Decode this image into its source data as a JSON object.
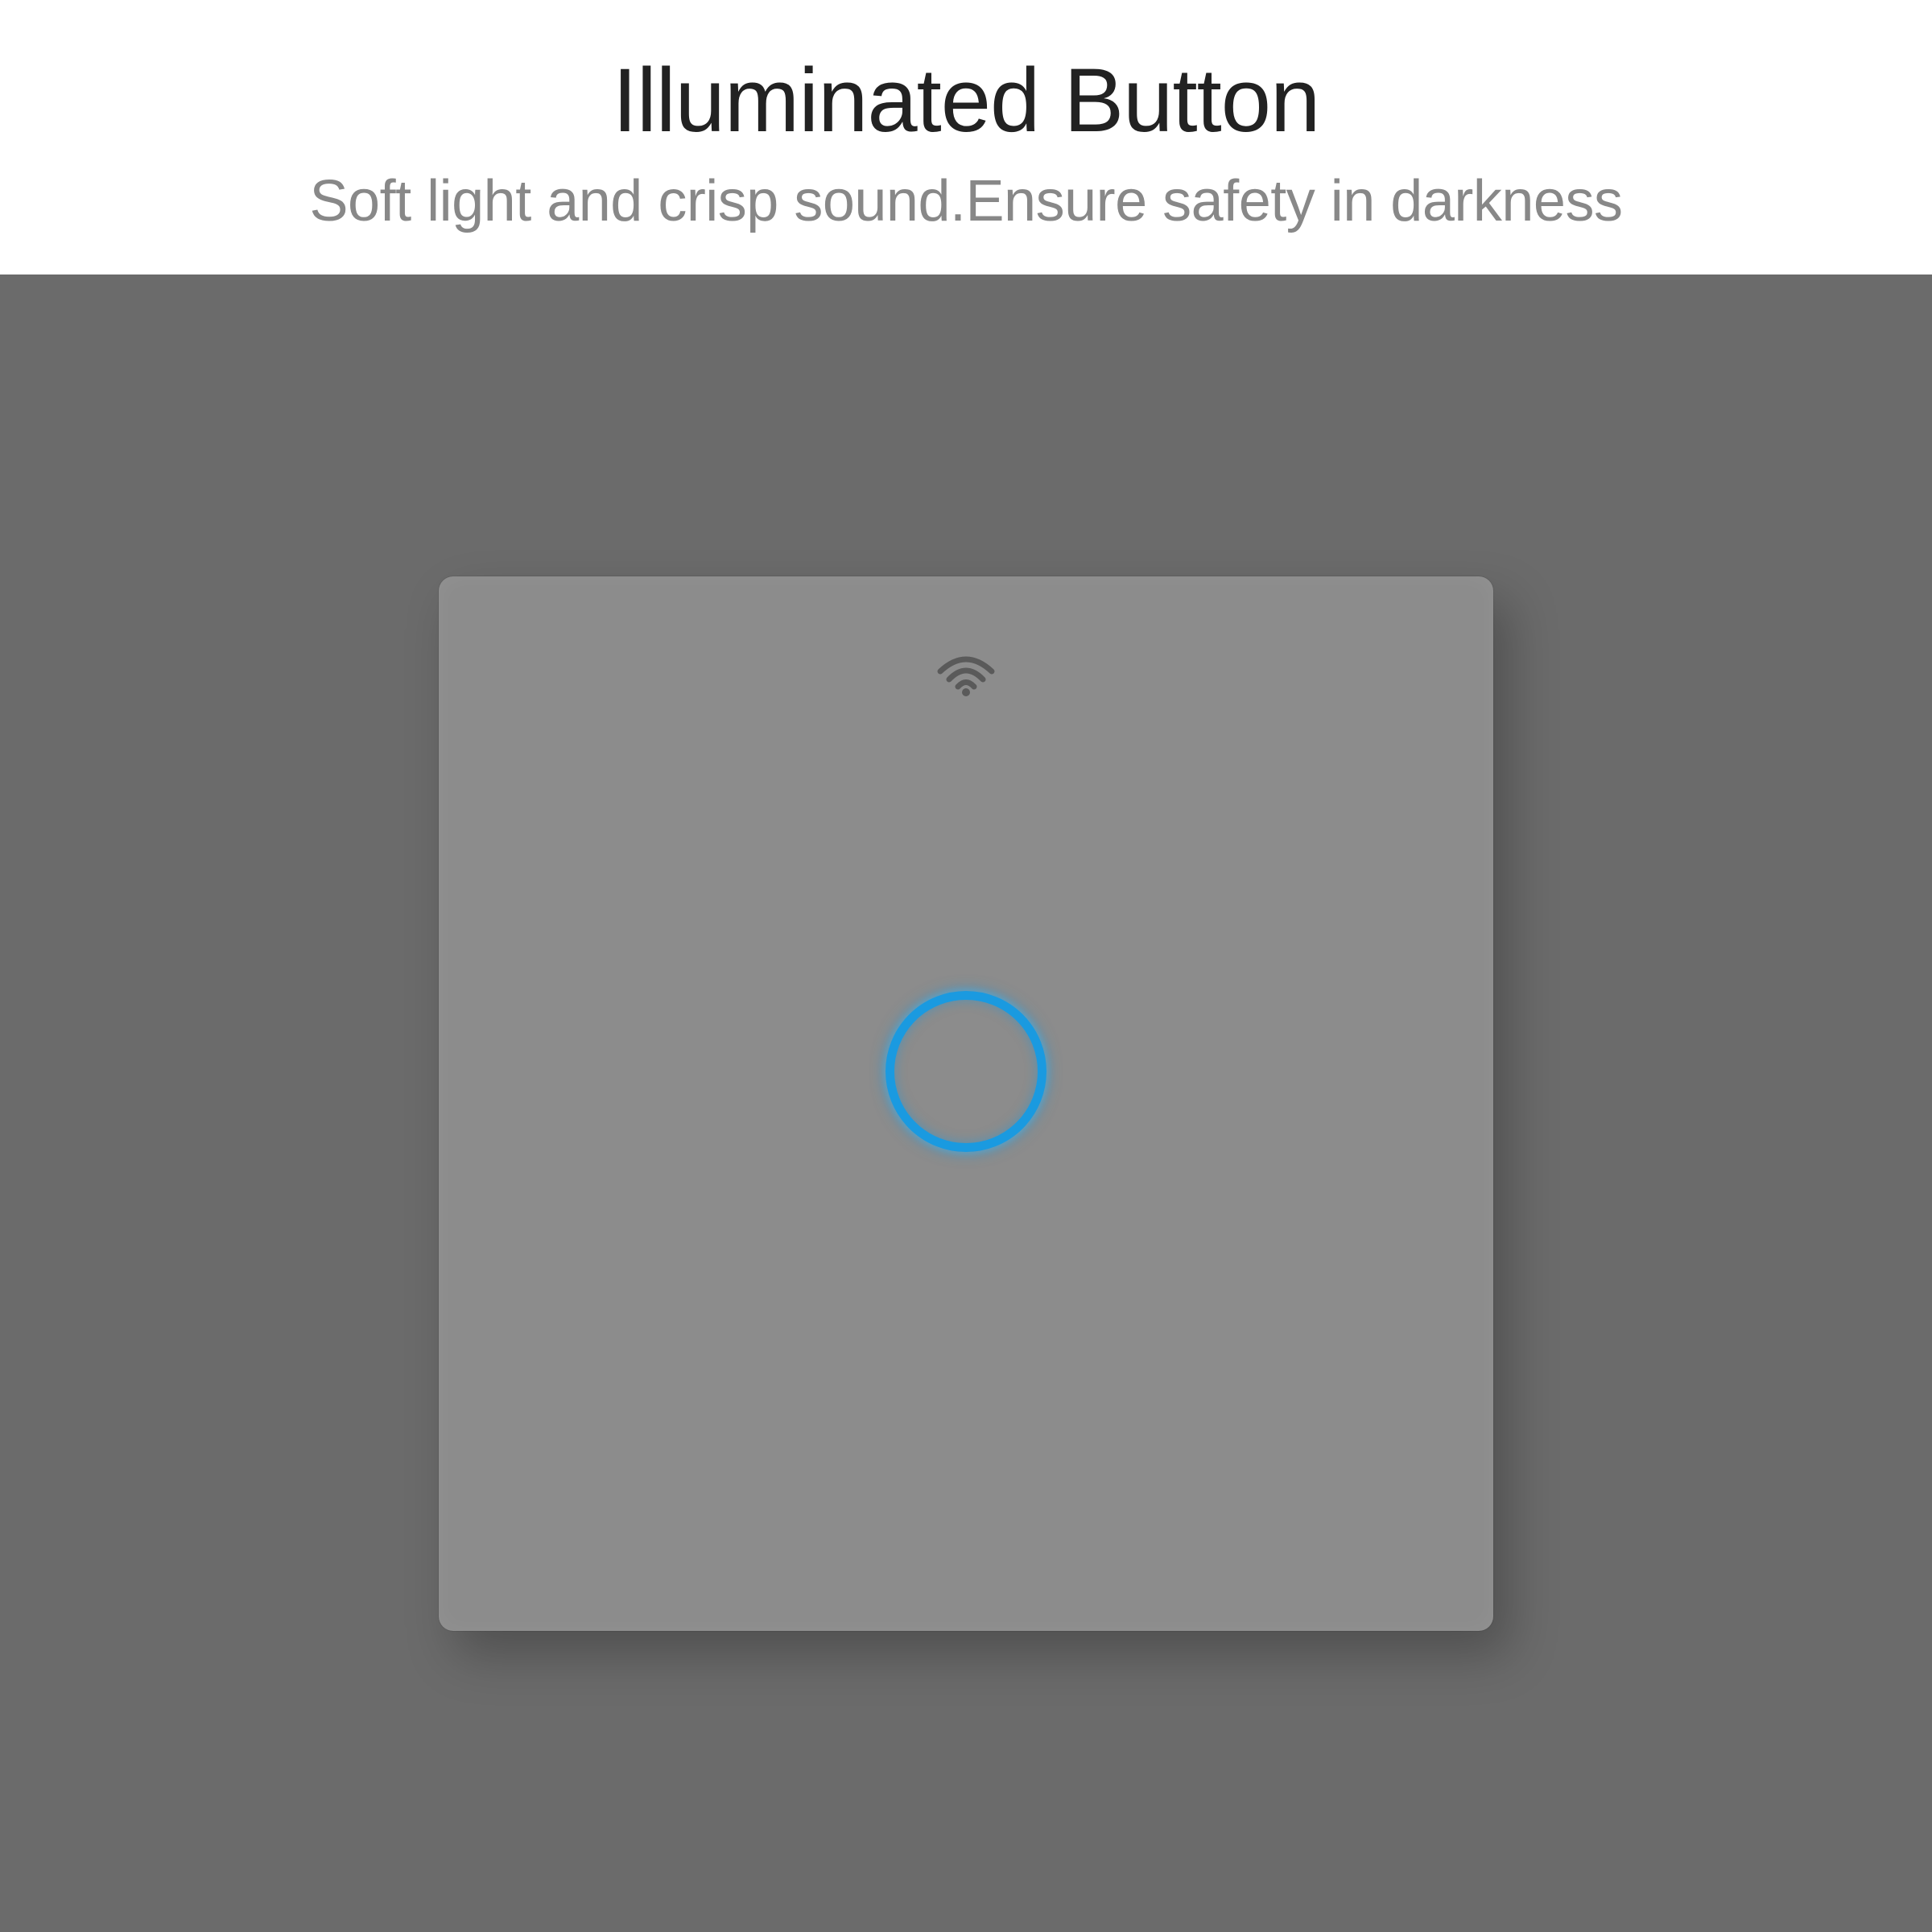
{
  "header": {
    "title": "Illuminated Button",
    "subtitle": "Soft light and crisp sound.Ensure safety in darkness"
  },
  "colors": {
    "ring": "#1a9ae0",
    "panel": "#8c8c8c",
    "scene": "#6b6b6b"
  },
  "icons": {
    "wifi": "wifi-icon"
  }
}
